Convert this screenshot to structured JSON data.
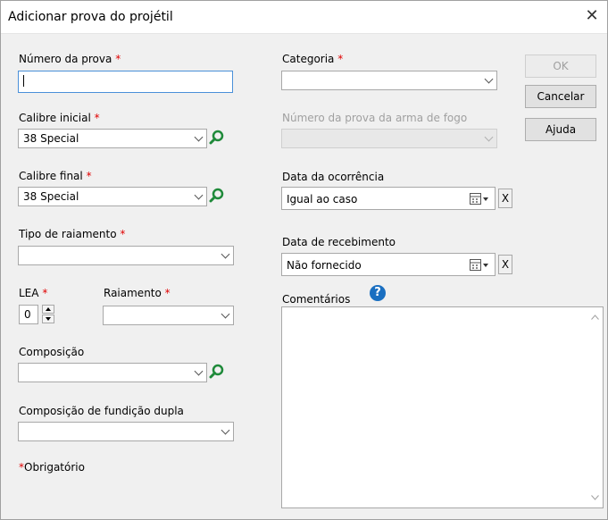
{
  "window": {
    "title": "Adicionar prova do projétil",
    "close_glyph": "✕"
  },
  "left": {
    "numero_prova": {
      "label": "Número da prova",
      "required": "*",
      "value": ""
    },
    "calibre_inicial": {
      "label": "Calibre inicial",
      "required": "*",
      "value": "38 Special"
    },
    "calibre_final": {
      "label": "Calibre final",
      "required": "*",
      "value": "38 Special"
    },
    "tipo_raiamento": {
      "label": "Tipo de raiamento",
      "required": "*",
      "value": ""
    },
    "lea": {
      "label": "LEA",
      "required": "*",
      "value": "0"
    },
    "raiamento": {
      "label": "Raiamento",
      "required": "*",
      "value": ""
    },
    "composicao": {
      "label": "Composição",
      "value": ""
    },
    "composicao_dupla": {
      "label": "Composição de fundição dupla",
      "value": ""
    },
    "required_note": {
      "star": "*",
      "text": "Obrigatório"
    }
  },
  "right": {
    "categoria": {
      "label": "Categoria",
      "required": "*",
      "value": ""
    },
    "numero_arma": {
      "label": "Número da prova da arma de fogo",
      "value": ""
    },
    "data_ocorrencia": {
      "label": "Data da ocorrência",
      "value": "Igual ao caso",
      "clear": "X"
    },
    "data_recebimento": {
      "label": "Data de recebimento",
      "value": "Não fornecido",
      "clear": "X"
    },
    "comentarios": {
      "label": "Comentários",
      "value": "",
      "help": "?"
    }
  },
  "buttons": {
    "ok": "OK",
    "cancelar": "Cancelar",
    "ajuda": "Ajuda"
  },
  "colors": {
    "required": "#e00000",
    "help": "#1a6fc1",
    "search_icon": "#1f8a3a",
    "focus_border": "#4a90d9"
  }
}
